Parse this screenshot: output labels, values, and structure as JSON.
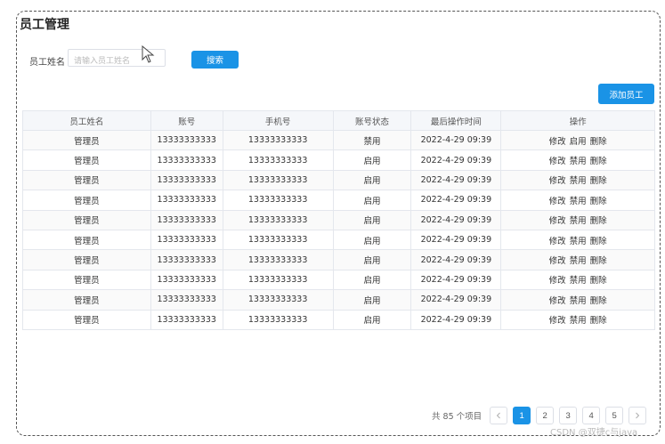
{
  "page": {
    "title": "员工管理"
  },
  "filter": {
    "name_label": "员工姓名",
    "name_placeholder": "请输入员工姓名",
    "name_value": "",
    "search_label": "搜索"
  },
  "toolbar": {
    "add_label": "添加员工"
  },
  "table": {
    "headers": [
      "员工姓名",
      "账号",
      "手机号",
      "账号状态",
      "最后操作时间",
      "操作"
    ],
    "rows": [
      {
        "name": "管理员",
        "account": "13333333333",
        "phone": "13333333333",
        "status": "禁用",
        "time": "2022-4-29 09:39",
        "actions": [
          "修改",
          "启用",
          "删除"
        ]
      },
      {
        "name": "管理员",
        "account": "13333333333",
        "phone": "13333333333",
        "status": "启用",
        "time": "2022-4-29 09:39",
        "actions": [
          "修改",
          "禁用",
          "删除"
        ]
      },
      {
        "name": "管理员",
        "account": "13333333333",
        "phone": "13333333333",
        "status": "启用",
        "time": "2022-4-29 09:39",
        "actions": [
          "修改",
          "禁用",
          "删除"
        ]
      },
      {
        "name": "管理员",
        "account": "13333333333",
        "phone": "13333333333",
        "status": "启用",
        "time": "2022-4-29 09:39",
        "actions": [
          "修改",
          "禁用",
          "删除"
        ]
      },
      {
        "name": "管理员",
        "account": "13333333333",
        "phone": "13333333333",
        "status": "启用",
        "time": "2022-4-29 09:39",
        "actions": [
          "修改",
          "禁用",
          "删除"
        ]
      },
      {
        "name": "管理员",
        "account": "13333333333",
        "phone": "13333333333",
        "status": "启用",
        "time": "2022-4-29 09:39",
        "actions": [
          "修改",
          "禁用",
          "删除"
        ]
      },
      {
        "name": "管理员",
        "account": "13333333333",
        "phone": "13333333333",
        "status": "启用",
        "time": "2022-4-29 09:39",
        "actions": [
          "修改",
          "禁用",
          "删除"
        ]
      },
      {
        "name": "管理员",
        "account": "13333333333",
        "phone": "13333333333",
        "status": "启用",
        "time": "2022-4-29 09:39",
        "actions": [
          "修改",
          "禁用",
          "删除"
        ]
      },
      {
        "name": "管理员",
        "account": "13333333333",
        "phone": "13333333333",
        "status": "启用",
        "time": "2022-4-29 09:39",
        "actions": [
          "修改",
          "禁用",
          "删除"
        ]
      },
      {
        "name": "管理员",
        "account": "13333333333",
        "phone": "13333333333",
        "status": "启用",
        "time": "2022-4-29 09:39",
        "actions": [
          "修改",
          "禁用",
          "删除"
        ]
      }
    ]
  },
  "pagination": {
    "total_text": "共 85 个项目",
    "pages": [
      "1",
      "2",
      "3",
      "4",
      "5"
    ],
    "current": "1",
    "prev_icon": "chevron-left-icon",
    "next_icon": "chevron-right-icon"
  },
  "watermark": "CSDN @双捷c与java",
  "colors": {
    "primary": "#1a93e6",
    "border": "#e4e7ed",
    "header_bg": "#f5f7fa"
  }
}
